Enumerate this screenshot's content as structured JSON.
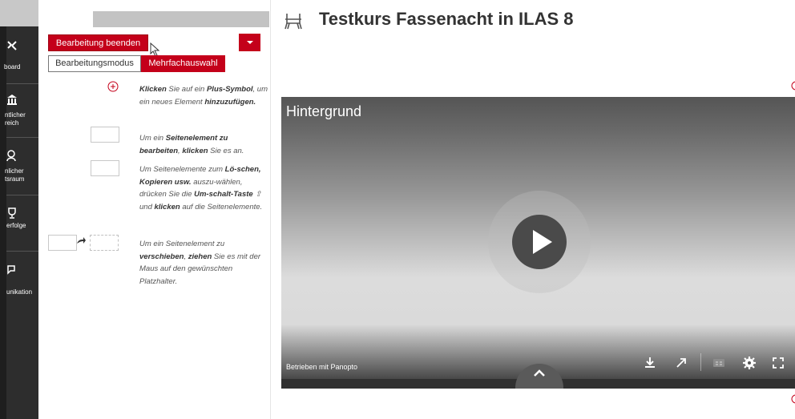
{
  "leftnav": {
    "items": [
      {
        "label": "board",
        "icon": "dashboard-icon"
      },
      {
        "label": "ntlicher\nreich",
        "icon": "institution-icon"
      },
      {
        "label": "nlicher\ntsraum",
        "icon": "search-person-icon"
      },
      {
        "label": "erfolge",
        "icon": "trophy-icon"
      },
      {
        "label": "unikation",
        "icon": "chat-icon"
      }
    ]
  },
  "slate": {
    "end_button_label": "Bearbeitung beenden",
    "mode_label": "Bearbeitungsmodus",
    "multi_select_label": "Mehrfachauswahl",
    "help": {
      "add_1": "Klicken",
      "add_2": " Sie auf ein ",
      "add_3": "Plus-Symbol",
      "add_4": ", um ein neues Element ",
      "add_5": "hinzuzufügen.",
      "edit_1": "Um ein ",
      "edit_2": "Seitenelement zu bearbeiten",
      "edit_3": ", ",
      "edit_4": "klicken",
      "edit_5": " Sie es an.",
      "del_1": "Um Seitenelemente zum ",
      "del_2": "Lö-schen, Kopieren usw.",
      "del_3": " auszu-wählen, drücken Sie die ",
      "del_4": "Um-schalt-Taste",
      "del_5": " ⇧ und ",
      "del_6": "klicken",
      "del_7": " auf die Seitenelemente.",
      "move_1": "Um ein Seitenelement zu ",
      "move_2": "verschieben",
      "move_3": ", ",
      "move_4": "ziehen",
      "move_5": " Sie es mit der Maus auf den gewünschten Platzhalter."
    }
  },
  "main": {
    "title": "Testkurs Fassenacht in ILAS 8",
    "title_icon": "course-icon"
  },
  "video": {
    "title": "Hintergrund",
    "powered_by": "Betrieben mit Panopto",
    "controls": [
      "download-icon",
      "open-external-icon",
      "captions-icon",
      "settings-icon",
      "fullscreen-icon"
    ]
  },
  "colors": {
    "accent": "#c4001a",
    "nav_bg": "#2d2d2d"
  }
}
